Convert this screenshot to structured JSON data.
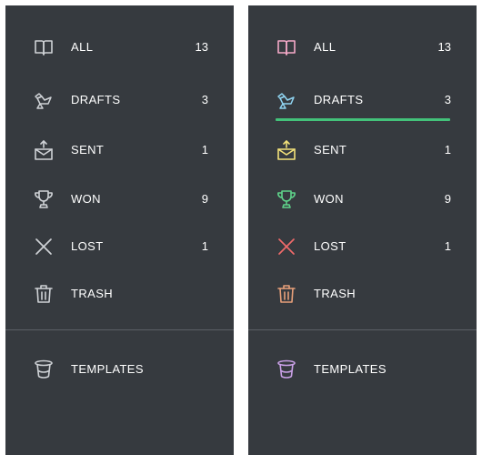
{
  "nav_items": [
    {
      "label": "ALL",
      "count": "13",
      "icon": "open-book-icon"
    },
    {
      "label": "DRAFTS",
      "count": "3",
      "icon": "origami-bird-icon"
    },
    {
      "label": "SENT",
      "count": "1",
      "icon": "envelope-upload-icon"
    },
    {
      "label": "WON",
      "count": "9",
      "icon": "trophy-icon"
    },
    {
      "label": "LOST",
      "count": "1",
      "icon": "x-icon"
    },
    {
      "label": "TRASH",
      "count": "",
      "icon": "trash-icon"
    }
  ],
  "templates_label": "TEMPLATES",
  "templates_icon": "hat-icon",
  "active_item": "DRAFTS",
  "colors": {
    "panel_bg": "#363a3f",
    "text": "#ffffff",
    "icon_default": "#cfd2d6",
    "active_underline": "#43c27a",
    "icon_all": "#f5a9c8",
    "icon_drafts": "#8fd3f0",
    "icon_sent": "#f3e27a",
    "icon_won": "#5fd38a",
    "icon_lost": "#f06a6a",
    "icon_trash": "#e8a07a",
    "icon_templates": "#c9a0e6"
  }
}
